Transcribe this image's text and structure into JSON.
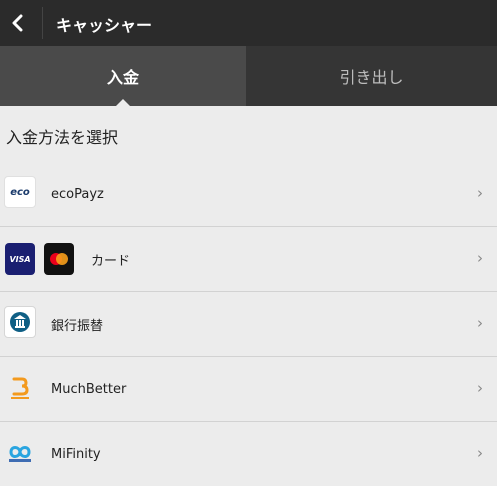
{
  "header": {
    "title": "キャッシャー"
  },
  "tabs": [
    {
      "label": "入金"
    },
    {
      "label": "引き出し"
    }
  ],
  "section_title": "入金方法を選択",
  "methods": [
    {
      "label": "ecoPayz",
      "icon": "ecopayz-logo-icon"
    },
    {
      "label": "カード",
      "icon": "visa-mastercard-icon"
    },
    {
      "label": "銀行振替",
      "icon": "bank-icon"
    },
    {
      "label": "MuchBetter",
      "icon": "muchbetter-logo-icon"
    },
    {
      "label": "MiFinity",
      "icon": "mifinity-logo-icon"
    }
  ],
  "logo_text": {
    "eco": "eco",
    "visa": "VISA"
  }
}
